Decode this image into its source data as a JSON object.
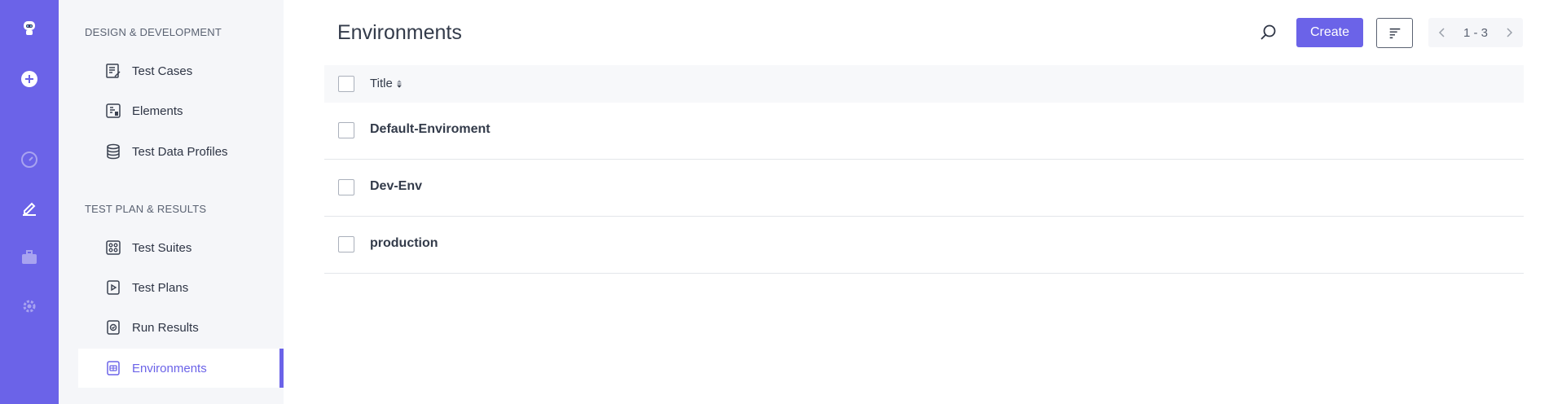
{
  "rail": {
    "icons": [
      "robot-logo-icon",
      "add-circle-icon",
      "dashboard-gauge-icon",
      "pencil-edit-icon",
      "briefcase-icon",
      "settings-gear-icon"
    ]
  },
  "sidebar": {
    "sections": [
      {
        "title": "DESIGN & DEVELOPMENT",
        "items": [
          {
            "label": "Test Cases",
            "icon": "test-cases-icon"
          },
          {
            "label": "Elements",
            "icon": "elements-icon"
          },
          {
            "label": "Test Data Profiles",
            "icon": "database-icon"
          }
        ]
      },
      {
        "title": "TEST PLAN & RESULTS",
        "items": [
          {
            "label": "Test Suites",
            "icon": "test-suites-icon"
          },
          {
            "label": "Test Plans",
            "icon": "test-plans-icon"
          },
          {
            "label": "Run Results",
            "icon": "run-results-icon"
          },
          {
            "label": "Environments",
            "icon": "environments-icon",
            "active": true
          }
        ]
      }
    ]
  },
  "main": {
    "title": "Environments",
    "create_label": "Create",
    "pager_range": "1 - 3",
    "table": {
      "column_title": "Title",
      "rows": [
        {
          "title": "Default-Enviroment"
        },
        {
          "title": "Dev-Env"
        },
        {
          "title": "production"
        }
      ]
    }
  },
  "colors": {
    "accent": "#6b63e8",
    "sidebar_bg": "#f5f6f9",
    "text": "#333b4a"
  }
}
